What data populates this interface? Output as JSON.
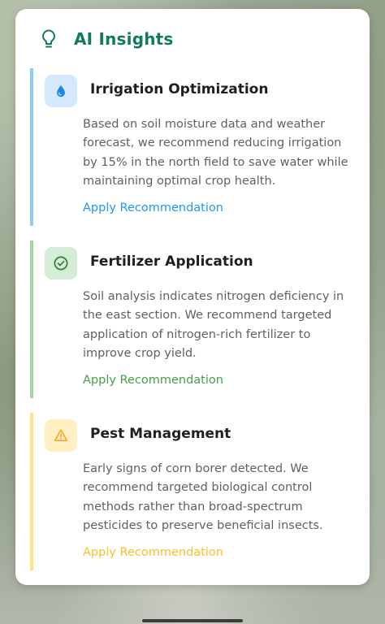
{
  "panel": {
    "title": "AI Insights",
    "title_icon": "lightbulb-icon",
    "accent_color": "#137a5f"
  },
  "insights": [
    {
      "title": "Irrigation Optimization",
      "icon": "water-drop-icon",
      "description": "Based on soil moisture data and weather forecast, we recommend reducing irrigation by 15% in the north field to save water while maintaining optimal crop health.",
      "action": "Apply Recommendation",
      "color": "#2196f3"
    },
    {
      "title": "Fertilizer Application",
      "icon": "check-circle-icon",
      "description": "Soil analysis indicates nitrogen deficiency in the east section. We recommend targeted application of nitrogen-rich fertilizer to improve crop yield.",
      "action": "Apply Recommendation",
      "color": "#43a047"
    },
    {
      "title": "Pest Management",
      "icon": "warning-triangle-icon",
      "description": "Early signs of corn borer detected. We recommend targeted biological control methods rather than broad-spectrum pesticides to preserve beneficial insects.",
      "action": "Apply Recommendation",
      "color": "#fbc02d"
    }
  ]
}
